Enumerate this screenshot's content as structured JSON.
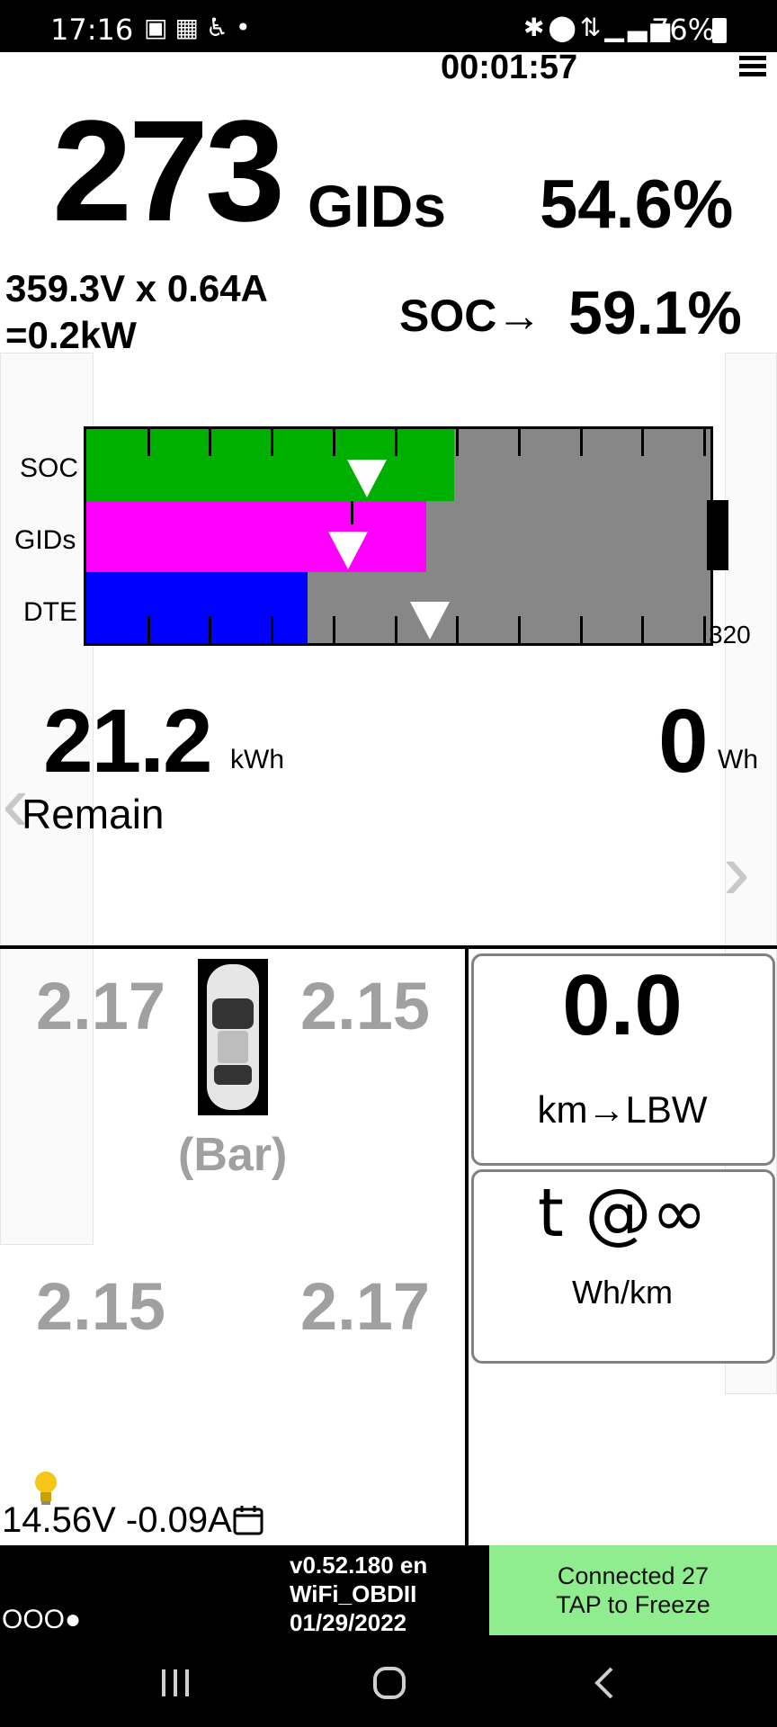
{
  "status_bar": {
    "time": "17:16",
    "left_icons": [
      "image-icon",
      "gallery-icon",
      "accessibility-icon",
      "dot-icon"
    ],
    "right_icons": [
      "bluetooth-icon",
      "location-icon",
      "data-icon",
      "signal-icon"
    ],
    "battery": "76%"
  },
  "header": {
    "timer": "00:01:57",
    "menu_icon": "hamburger-menu-icon"
  },
  "gids": {
    "value": "273",
    "unit": "GIDs",
    "percent": "54.6%"
  },
  "power": {
    "line1": "359.3V x 0.64A",
    "line2": "=0.2kW"
  },
  "soc": {
    "label": "SOC→",
    "value": "59.1%"
  },
  "bar_chart": {
    "rows": [
      {
        "label": "SOC",
        "fill_fraction": 0.59,
        "marker_fraction": 0.45,
        "color": "#00b000"
      },
      {
        "label": "GIDs",
        "fill_fraction": 0.545,
        "marker_fraction": 0.42,
        "color": "#ff00ff"
      },
      {
        "label": "DTE",
        "fill_fraction": 0.355,
        "marker_fraction": 0.55,
        "color": "#0000ff"
      }
    ],
    "max_label": "320",
    "background_color": "#878787"
  },
  "energy": {
    "remain_value": "21.2",
    "remain_unit": "kWh",
    "remain_label": "Remain",
    "used_value": "0",
    "used_unit": "Wh"
  },
  "tires": {
    "front_left": "2.17",
    "front_right": "2.15",
    "rear_left": "2.15",
    "rear_right": "2.17",
    "unit": "(Bar)"
  },
  "range": {
    "value": "0.0",
    "label": "km→LBW"
  },
  "efficiency": {
    "value": "t @∞",
    "label": "Wh/km"
  },
  "aux_battery": {
    "text": "14.56V -0.09A",
    "bulb_icon": "lightbulb-icon",
    "calendar_icon": "calendar-icon"
  },
  "footer": {
    "dots": "OOO●",
    "version": "v0.52.180 en",
    "adapter": "WiFi_OBDII",
    "date": "01/29/2022",
    "connected": "Connected 27",
    "tap": "TAP to Freeze"
  }
}
